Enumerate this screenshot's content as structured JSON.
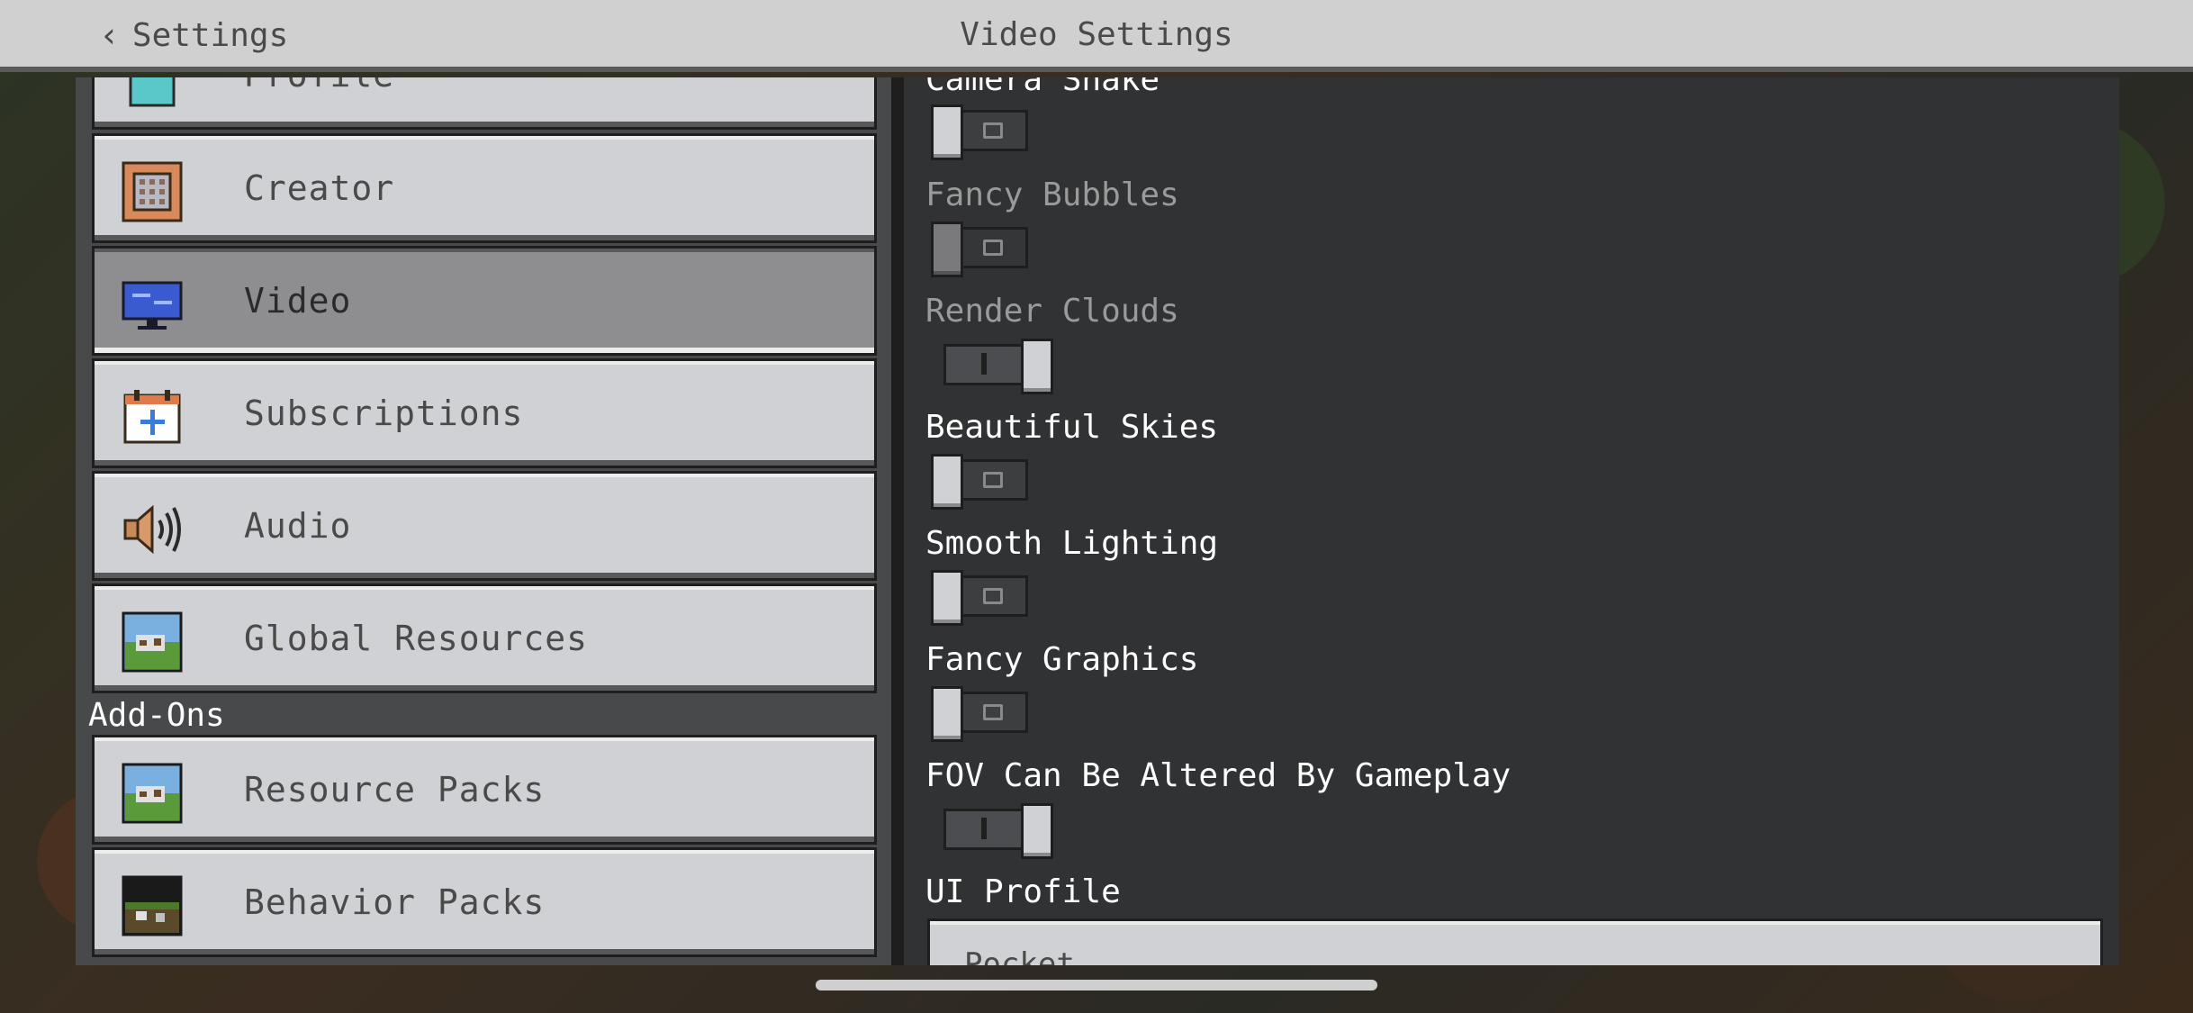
{
  "header": {
    "back_label": "Settings",
    "title": "Video Settings"
  },
  "sidebar": {
    "items": [
      {
        "label": "Profile",
        "icon": "profile-icon"
      },
      {
        "label": "Creator",
        "icon": "creator-icon"
      },
      {
        "label": "Video",
        "icon": "monitor-icon",
        "selected": true
      },
      {
        "label": "Subscriptions",
        "icon": "calendar-plus-icon"
      },
      {
        "label": "Audio",
        "icon": "speaker-icon"
      },
      {
        "label": "Global Resources",
        "icon": "resource-pack-icon"
      }
    ],
    "addons_header": "Add-Ons",
    "addons": [
      {
        "label": "Resource Packs",
        "icon": "resource-pack-icon"
      },
      {
        "label": "Behavior Packs",
        "icon": "behavior-pack-icon"
      }
    ]
  },
  "settings": [
    {
      "label": "Camera Shake",
      "state": "off",
      "enabled": true
    },
    {
      "label": "Fancy Bubbles",
      "state": "off",
      "enabled": false
    },
    {
      "label": "Render Clouds",
      "state": "on",
      "enabled": false
    },
    {
      "label": "Beautiful Skies",
      "state": "off",
      "enabled": true
    },
    {
      "label": "Smooth Lighting",
      "state": "off",
      "enabled": true
    },
    {
      "label": "Fancy Graphics",
      "state": "off",
      "enabled": true
    },
    {
      "label": "FOV Can Be Altered By Gameplay",
      "state": "on",
      "enabled": true
    }
  ],
  "ui_profile": {
    "label": "UI Profile",
    "value": "Pocket"
  },
  "colors": {
    "header_bg": "#d0d0d0",
    "panel_bg": "#313233",
    "button_bg": "#d0d1d4",
    "selected_bg": "#8e8e90"
  }
}
